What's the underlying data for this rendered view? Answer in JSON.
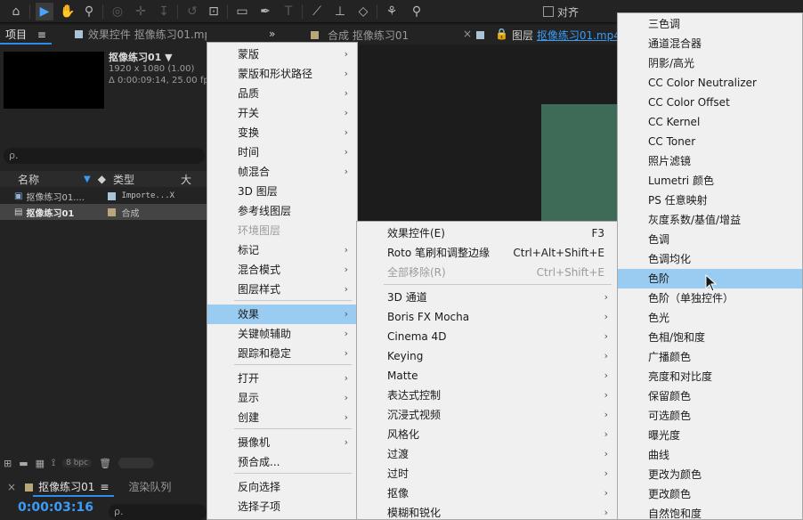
{
  "toolbar": {
    "snap_label": "对齐",
    "tools": [
      "home-icon",
      "selection-icon",
      "hand-icon",
      "zoom-icon",
      "orbit-icon",
      "pan-icon",
      "dolly-icon",
      "rotate-icon",
      "anchor-icon",
      "rectangle-icon",
      "pen-icon",
      "type-icon",
      "brush-icon",
      "stamp-icon",
      "eraser-icon",
      "roto-brush-icon",
      "puppet-pin-icon"
    ]
  },
  "project_panel": {
    "tabs": [
      "项目",
      "效果控件 抠像练习01.mp4"
    ],
    "menu_glyph": "≡",
    "expand_glyph": "»",
    "comp_name": "抠像练习01 ▼",
    "comp_dims": "1920 x 1080 (1.00)",
    "comp_duration": "Δ 0:00:09:14, 25.00 fps",
    "search_placeholder": "ρ.",
    "columns": {
      "name": "名称",
      "type": "类型",
      "size": "大"
    },
    "rows": [
      {
        "name": "抠像练习01....",
        "type": "Importe...X",
        "label_color": "#a9c4d6",
        "selected": false
      },
      {
        "name": "抠像练习01",
        "type": "合成",
        "label_color": "#b9a67a",
        "selected": true
      }
    ],
    "bpc": "8 bpc"
  },
  "timeline": {
    "tab_label": "抠像练习01",
    "render_queue": "渲染队列",
    "timecode": "0:00:03:16",
    "search_placeholder": "ρ."
  },
  "top_tabs": {
    "comp_tab": "合成 抠像练习01",
    "layer_prefix": "图层",
    "layer_name": "抠像练习01.mp4"
  },
  "context_menu": {
    "items": [
      {
        "label": "蒙版",
        "arrow": true
      },
      {
        "label": "蒙版和形状路径",
        "arrow": true
      },
      {
        "label": "品质",
        "arrow": true
      },
      {
        "label": "开关",
        "arrow": true
      },
      {
        "label": "变换",
        "arrow": true
      },
      {
        "label": "时间",
        "arrow": true
      },
      {
        "label": "帧混合",
        "arrow": true
      },
      {
        "label": "3D 图层"
      },
      {
        "label": "参考线图层"
      },
      {
        "label": "环境图层",
        "disabled": true
      },
      {
        "label": "标记",
        "arrow": true
      },
      {
        "label": "混合模式",
        "arrow": true
      },
      {
        "label": "图层样式",
        "arrow": true
      },
      {
        "label": "效果",
        "arrow": true,
        "highlighted": true
      },
      {
        "label": "关键帧辅助",
        "arrow": true
      },
      {
        "label": "跟踪和稳定",
        "arrow": true
      },
      {
        "label": "打开",
        "arrow": true
      },
      {
        "label": "显示",
        "arrow": true
      },
      {
        "label": "创建",
        "arrow": true
      },
      {
        "label": "摄像机",
        "arrow": true
      },
      {
        "label": "预合成..."
      },
      {
        "label": "反向选择"
      },
      {
        "label": "选择子项"
      }
    ]
  },
  "effects_menu": {
    "items": [
      {
        "label": "效果控件(E)",
        "shortcut": "F3"
      },
      {
        "label": "Roto 笔刷和调整边缘",
        "shortcut": "Ctrl+Alt+Shift+E"
      },
      {
        "label": "全部移除(R)",
        "shortcut": "Ctrl+Shift+E",
        "disabled": true
      },
      {
        "label": "3D 通道",
        "arrow": true
      },
      {
        "label": "Boris FX Mocha",
        "arrow": true
      },
      {
        "label": "Cinema 4D",
        "arrow": true
      },
      {
        "label": "Keying",
        "arrow": true
      },
      {
        "label": "Matte",
        "arrow": true
      },
      {
        "label": "表达式控制",
        "arrow": true
      },
      {
        "label": "沉浸式视频",
        "arrow": true
      },
      {
        "label": "风格化",
        "arrow": true
      },
      {
        "label": "过渡",
        "arrow": true
      },
      {
        "label": "过时",
        "arrow": true
      },
      {
        "label": "抠像",
        "arrow": true
      },
      {
        "label": "模糊和锐化",
        "arrow": true
      }
    ]
  },
  "color_menu": {
    "items": [
      {
        "label": "三色调"
      },
      {
        "label": "通道混合器"
      },
      {
        "label": "阴影/高光"
      },
      {
        "label": "CC Color Neutralizer"
      },
      {
        "label": "CC Color Offset"
      },
      {
        "label": "CC Kernel"
      },
      {
        "label": "CC Toner"
      },
      {
        "label": "照片滤镜"
      },
      {
        "label": "Lumetri 颜色"
      },
      {
        "label": "PS 任意映射"
      },
      {
        "label": "灰度系数/基值/增益"
      },
      {
        "label": "色调"
      },
      {
        "label": "色调均化"
      },
      {
        "label": "色阶",
        "highlighted": true
      },
      {
        "label": "色阶（单独控件）"
      },
      {
        "label": "色光"
      },
      {
        "label": "色相/饱和度"
      },
      {
        "label": "广播颜色"
      },
      {
        "label": "亮度和对比度"
      },
      {
        "label": "保留颜色"
      },
      {
        "label": "可选颜色"
      },
      {
        "label": "曝光度"
      },
      {
        "label": "曲线"
      },
      {
        "label": "更改为颜色"
      },
      {
        "label": "更改颜色"
      },
      {
        "label": "自然饱和度"
      }
    ]
  }
}
